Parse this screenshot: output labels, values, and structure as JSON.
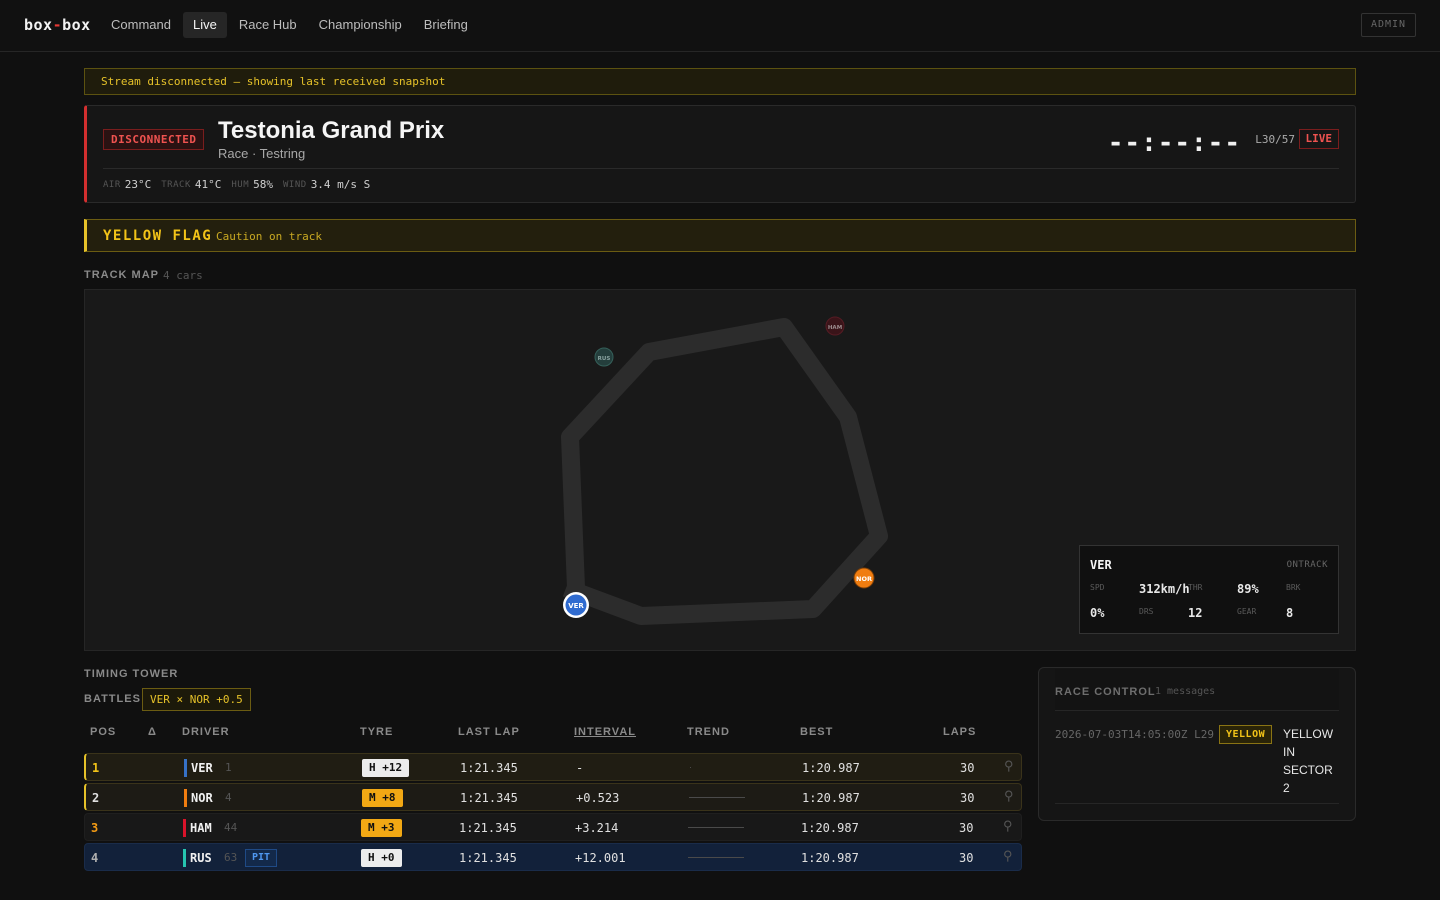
{
  "nav": {
    "brand_left": "box",
    "brand_dash": "-",
    "brand_right": "box",
    "links": [
      "Command",
      "Live",
      "Race Hub",
      "Championship",
      "Briefing"
    ],
    "active": "Live",
    "admin_label": "ADMIN"
  },
  "stream_banner": "Stream disconnected — showing last received snapshot",
  "session": {
    "status": "DISCONNECTED",
    "title": "Testonia Grand Prix",
    "subtitle": "Race · Testring",
    "clock": "--:--:--",
    "lap": "L30/57",
    "live": "LIVE",
    "weather": [
      {
        "k": "AIR",
        "v": "23°C"
      },
      {
        "k": "TRACK",
        "v": "41°C"
      },
      {
        "k": "HUM",
        "v": "58%"
      },
      {
        "k": "WIND",
        "v": "3.4 m/s S"
      }
    ]
  },
  "flag": {
    "title": "YELLOW FLAG",
    "message": "Caution on track"
  },
  "trackmap": {
    "label": "TRACK MAP",
    "count": "4 cars",
    "cars": [
      {
        "code": "VER",
        "color": "#2f6bd0"
      },
      {
        "code": "NOR",
        "color": "#f07d10"
      },
      {
        "code": "HAM",
        "color": "#5a1a22"
      },
      {
        "code": "RUS",
        "color": "#2d5a55"
      }
    ],
    "selected": {
      "driver": "VER",
      "status": "ONTRACK",
      "spd_k": "SPD",
      "spd_v": "312km/h",
      "thr_k": "THR",
      "thr_v": "89%",
      "brk_k": "BRK",
      "brk_v": "0%",
      "drs_k": "DRS",
      "drs_v": "12",
      "gear_k": "GEAR",
      "gear_v": "8"
    }
  },
  "timing": {
    "label": "TIMING TOWER",
    "battles_label": "BATTLES",
    "battle": "VER ⨯ NOR +0.5",
    "headers": {
      "pos": "POS",
      "delta": "Δ",
      "driver": "DRIVER",
      "tyre": "TYRE",
      "last_lap": "LAST LAP",
      "interval": "INTERVAL",
      "trend": "TREND",
      "best": "BEST",
      "laps": "LAPS"
    },
    "rows": [
      {
        "pos": "1",
        "driver": "VER",
        "num": "1",
        "team": "#3671c6",
        "tyre": "H +12",
        "compound": "H",
        "last": "1:21.345",
        "interval": "-",
        "best": "1:20.987",
        "laps": "30",
        "pit": "",
        "pos_color": "#f2c318"
      },
      {
        "pos": "2",
        "driver": "NOR",
        "num": "4",
        "team": "#f07d10",
        "tyre": "M +8",
        "compound": "M",
        "last": "1:21.345",
        "interval": "+0.523",
        "best": "1:20.987",
        "laps": "30",
        "pit": "",
        "pos_color": "#e0e0e0"
      },
      {
        "pos": "3",
        "driver": "HAM",
        "num": "44",
        "team": "#d8132a",
        "tyre": "M +3",
        "compound": "M",
        "last": "1:21.345",
        "interval": "+3.214",
        "best": "1:20.987",
        "laps": "30",
        "pit": "",
        "pos_color": "#f29a14"
      },
      {
        "pos": "4",
        "driver": "RUS",
        "num": "63",
        "team": "#26c4b0",
        "tyre": "H +0",
        "compound": "H",
        "last": "1:21.345",
        "interval": "+12.001",
        "best": "1:20.987",
        "laps": "30",
        "pit": "PIT",
        "pos_color": "#b0b0b0"
      }
    ]
  },
  "race_control": {
    "title": "RACE CONTROL",
    "count": "1 messages",
    "messages": [
      {
        "time": "2026-07-03T14:05:00Z",
        "lap": "L29",
        "badge": "YELLOW",
        "text": "YELLOW IN SECTOR 2"
      }
    ]
  }
}
